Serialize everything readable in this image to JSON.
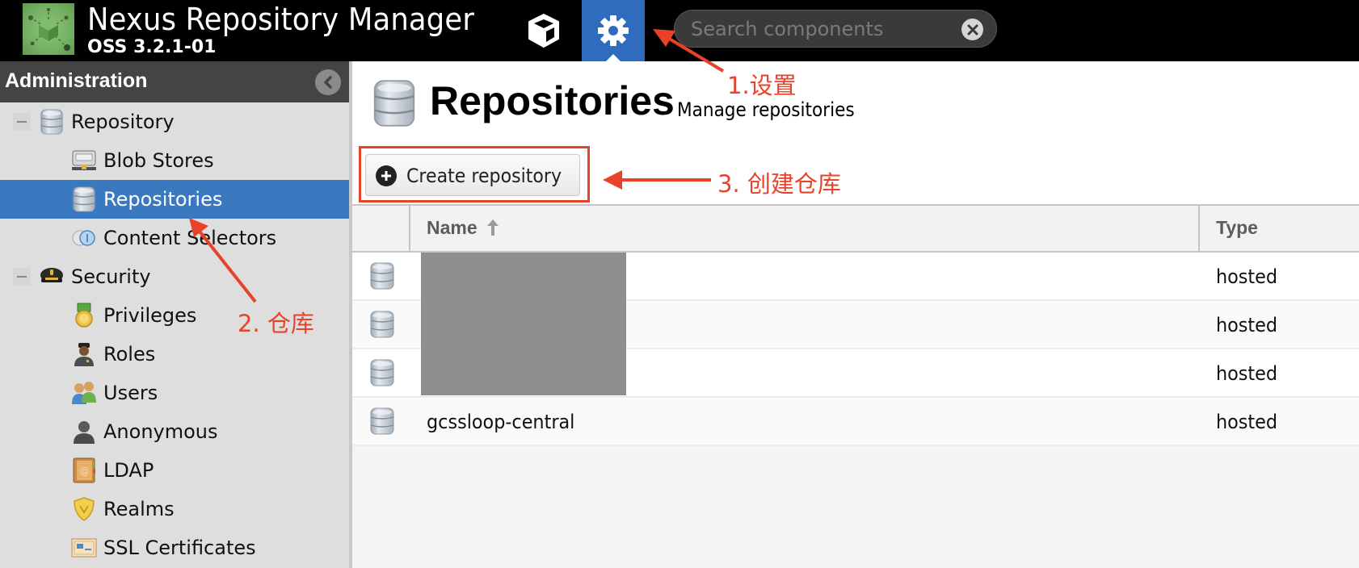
{
  "header": {
    "app_title": "Nexus Repository Manager",
    "version": "OSS 3.2.1-01",
    "browse_button_icon": "cube-icon",
    "admin_button_icon": "gear-icon",
    "search": {
      "placeholder": "Search components",
      "value": ""
    }
  },
  "sidebar": {
    "title": "Administration",
    "items": [
      {
        "label": "Repository",
        "icon": "database-icon",
        "level": 0,
        "expanded": true
      },
      {
        "label": "Blob Stores",
        "icon": "server-icon",
        "level": 1
      },
      {
        "label": "Repositories",
        "icon": "database-icon",
        "level": 1,
        "selected": true
      },
      {
        "label": "Content Selectors",
        "icon": "selectors-icon",
        "level": 1
      },
      {
        "label": "Security",
        "icon": "police-cap-icon",
        "level": 0,
        "expanded": true
      },
      {
        "label": "Privileges",
        "icon": "medal-icon",
        "level": 1
      },
      {
        "label": "Roles",
        "icon": "officer-icon",
        "level": 1
      },
      {
        "label": "Users",
        "icon": "users-icon",
        "level": 1
      },
      {
        "label": "Anonymous",
        "icon": "anonymous-user-icon",
        "level": 1
      },
      {
        "label": "LDAP",
        "icon": "address-book-icon",
        "level": 1
      },
      {
        "label": "Realms",
        "icon": "shield-icon",
        "level": 1
      },
      {
        "label": "SSL Certificates",
        "icon": "certificate-icon",
        "level": 1
      }
    ]
  },
  "main": {
    "title": "Repositories",
    "subtitle": "Manage repositories",
    "create_button": "Create repository",
    "grid": {
      "columns": [
        {
          "label": ""
        },
        {
          "label": "Name",
          "sort": "ascending"
        },
        {
          "label": "Type"
        }
      ],
      "rows": [
        {
          "name": "",
          "type": "hosted",
          "redacted": true
        },
        {
          "name": "",
          "type": "hosted",
          "redacted": true
        },
        {
          "name": "",
          "type": "hosted",
          "redacted": true
        },
        {
          "name": "gcssloop-central",
          "type": "hosted"
        }
      ]
    }
  },
  "annotations": {
    "color": "#e8432a",
    "step1": "1.设置",
    "step2": "2. 仓库",
    "step3": "3. 创建仓库"
  },
  "colors": {
    "accent_blue": "#2f6cbe",
    "selected_row": "#3a78c0",
    "topbar": "#000000",
    "sidebar_bg": "#dedede",
    "sidebar_header": "#444444"
  }
}
